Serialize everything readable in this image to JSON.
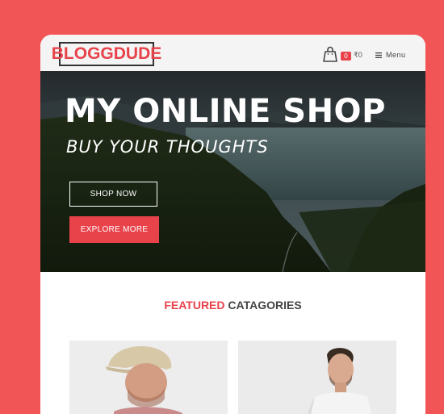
{
  "header": {
    "logo_text": "BLOGGDUDE",
    "cart_count": "0",
    "cart_total": "₹0",
    "menu_label": "Menu"
  },
  "hero": {
    "title": "MY ONLINE SHOP",
    "subtitle": "BUY YOUR THOUGHTS",
    "shop_button": "SHOP NOW",
    "explore_button": "EXPLORE MORE"
  },
  "featured": {
    "title_accent": "FEATURED",
    "title_rest": " CATAGORIES"
  },
  "colors": {
    "brand": "#e8434b",
    "background": "#f25555"
  },
  "icons": [
    "shopping-bag-icon",
    "menu-icon"
  ]
}
